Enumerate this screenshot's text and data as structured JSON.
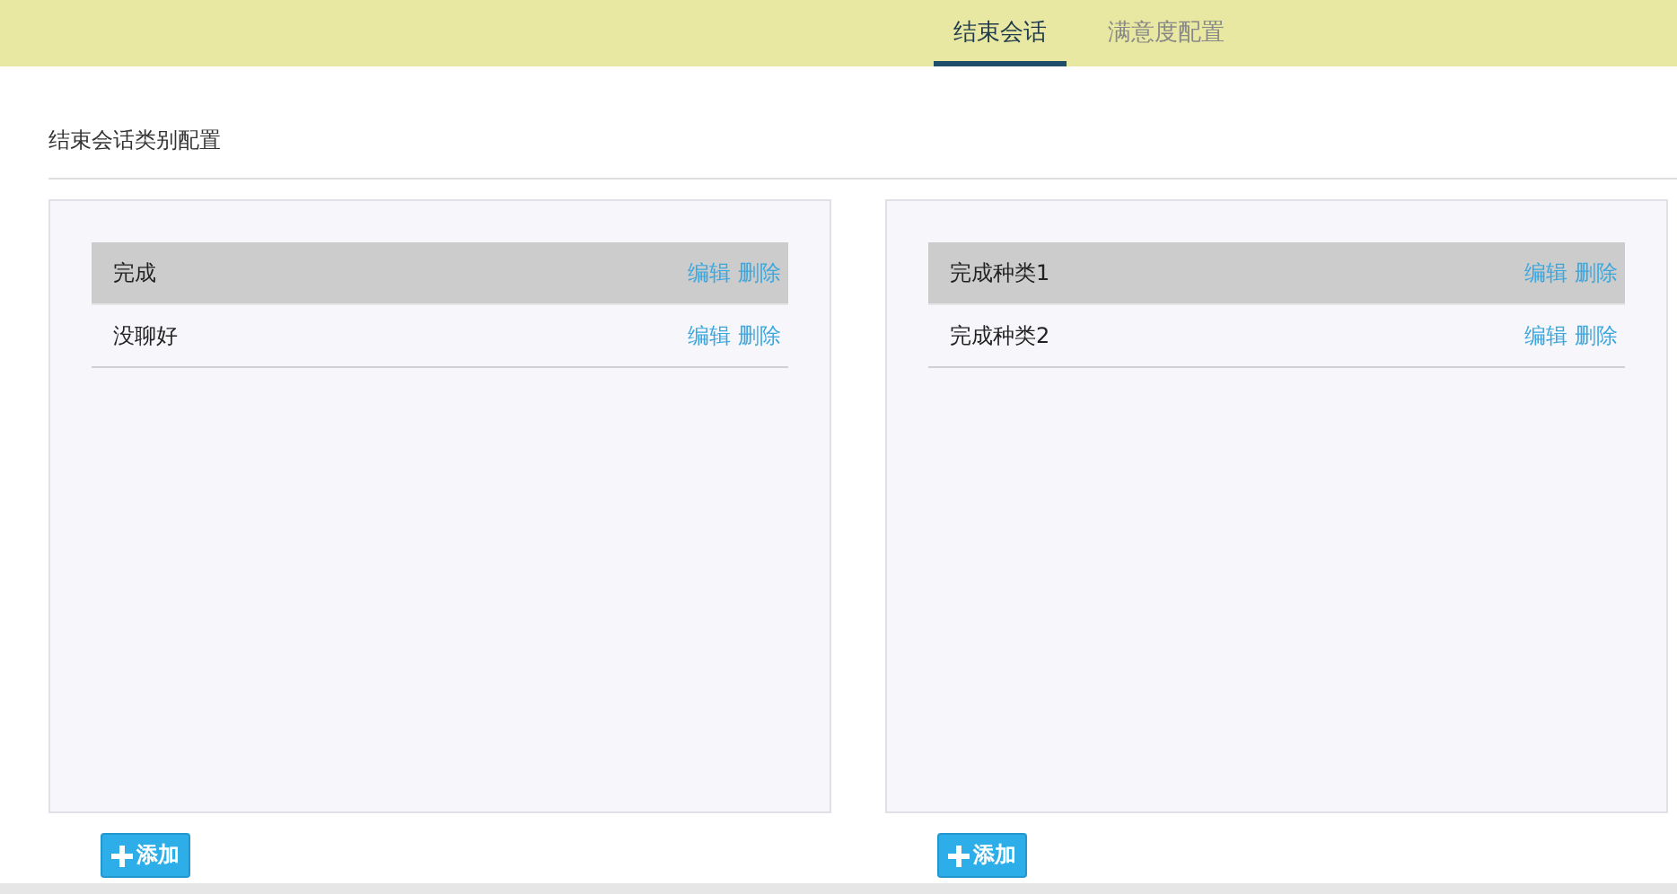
{
  "tabs": [
    {
      "label": "结束会话",
      "selected": true
    },
    {
      "label": "满意度配置",
      "selected": false
    }
  ],
  "section_title": "结束会话类别配置",
  "panels": [
    {
      "rows": [
        {
          "name": "完成",
          "selected": true,
          "edit": "编辑",
          "delete": "删除"
        },
        {
          "name": "没聊好",
          "selected": false,
          "edit": "编辑",
          "delete": "删除"
        }
      ],
      "add_button": "添加"
    },
    {
      "rows": [
        {
          "name": "完成种类1",
          "selected": true,
          "edit": "编辑",
          "delete": "删除"
        },
        {
          "name": "完成种类2",
          "selected": false,
          "edit": "编辑",
          "delete": "删除"
        }
      ],
      "add_button": "添加"
    }
  ]
}
